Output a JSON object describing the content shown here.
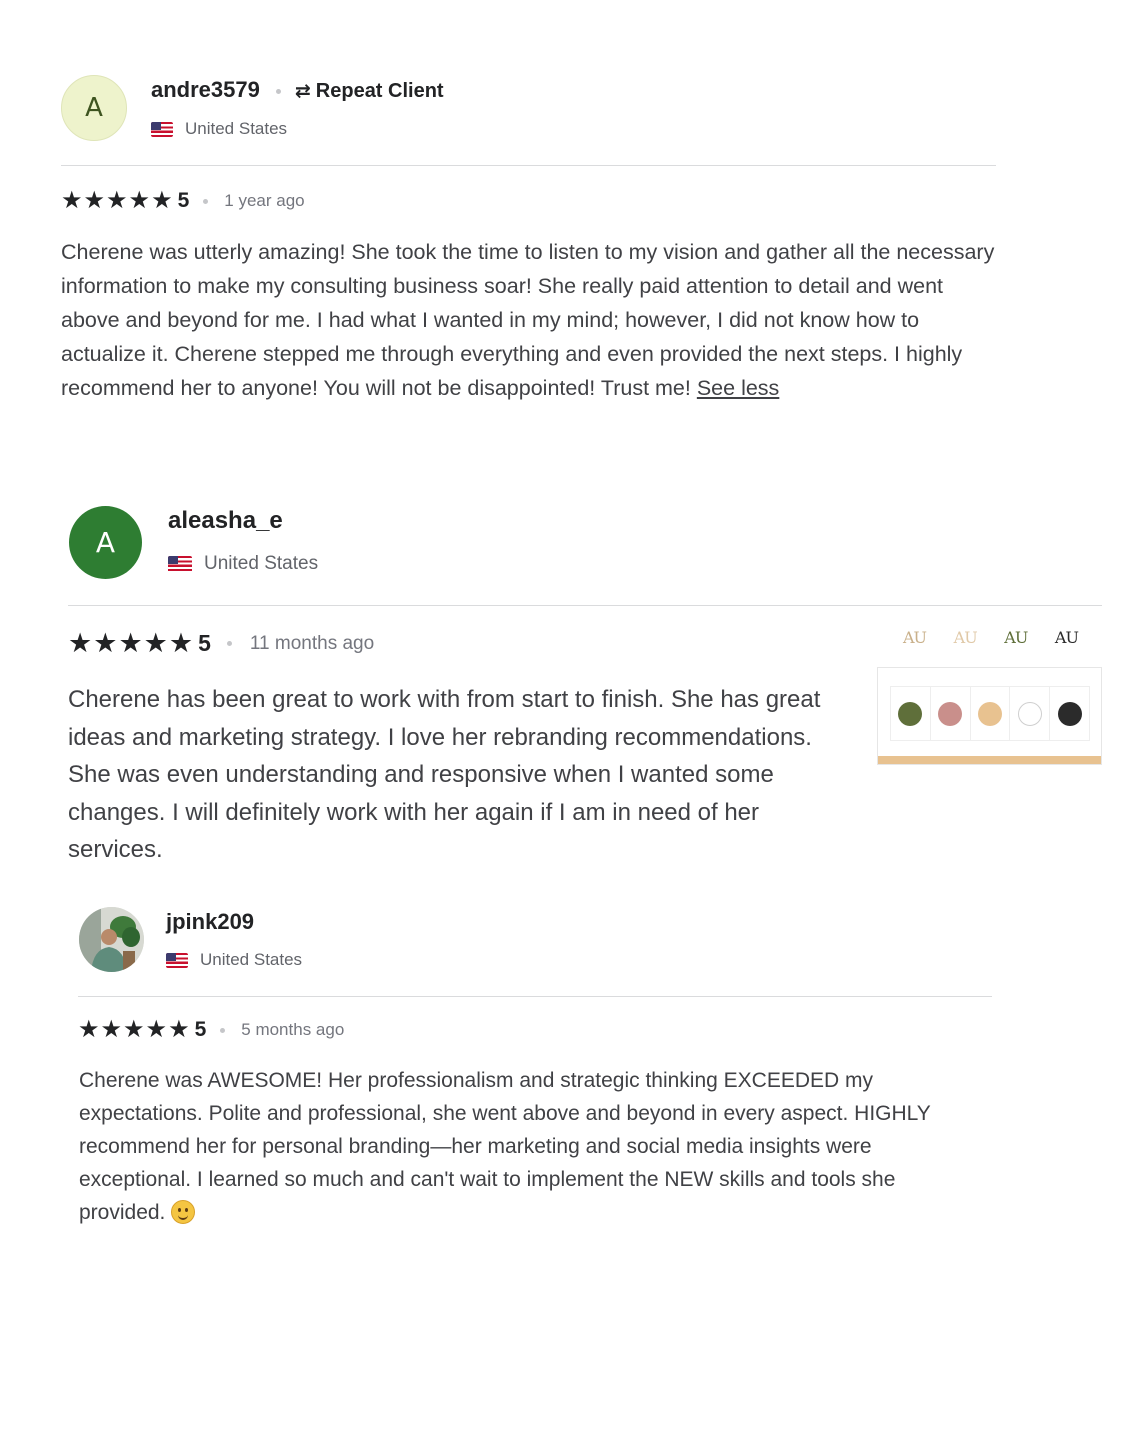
{
  "reviews": [
    {
      "avatar_letter": "A",
      "username": "andre3579",
      "badge": "Repeat Client",
      "country": "United States",
      "rating": 5,
      "score": "5",
      "time_ago": "1 year ago",
      "text": "Cherene was utterly amazing! She took the time to listen to my vision and gather all the necessary information to make my consulting business soar! She really paid attention to detail and went above and beyond for me. I had what I wanted in my mind; however, I did not know how to actualize it. Cherene stepped me through everything and even provided the next steps. I highly recommend her to anyone! You will not be disappointed! Trust me!",
      "see_less": "See less"
    },
    {
      "avatar_letter": "A",
      "username": "aleasha_e",
      "country": "United States",
      "rating": 5,
      "score": "5",
      "time_ago": "11 months ago",
      "text": "Cherene has been great to work with from start to finish. She has great ideas and marketing strategy. I love her rebranding recommendations. She was even understanding and responsive when I wanted some changes. I will definitely work with her again if I am in need of her services.",
      "portfolio": {
        "logos": [
          "AU",
          "AU",
          "AU",
          "AU"
        ],
        "swatch_colors": [
          "#5f6f3a",
          "#c98f8b",
          "#e8c290",
          "#ffffff",
          "#2b2b2b"
        ]
      }
    },
    {
      "username": "jpink209",
      "country": "United States",
      "rating": 5,
      "score": "5",
      "time_ago": "5 months ago",
      "text": "Cherene was AWESOME! Her professionalism and strategic thinking EXCEEDED my expectations. Polite and professional, she went above and beyond in every aspect. HIGHLY recommend her for personal branding—her marketing and social media insights were exceptional. I learned so much and can't wait to implement the NEW skills and tools she provided."
    }
  ],
  "colors": {
    "avatar1_bg": "#eef3cc",
    "avatar1_text": "#3e5420",
    "avatar2_bg": "#2e7d32",
    "avatar2_text": "#ffffff",
    "star": "#222325",
    "divider": "#dadbdd"
  },
  "icons": {
    "repeat": "repeat-icon",
    "star": "star-icon",
    "flag": "us-flag-icon",
    "emoji": "smiling-face-icon"
  }
}
